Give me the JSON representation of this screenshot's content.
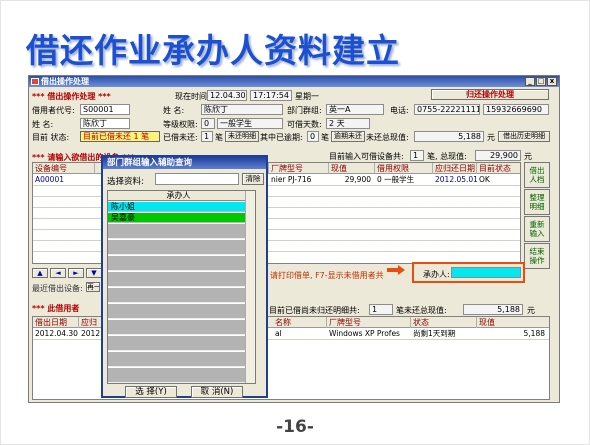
{
  "slide": {
    "title": "借还作业承办人资料建立",
    "page": "-16-"
  },
  "window": {
    "title": "借出操作处理",
    "ctrl_min": "_",
    "ctrl_max": "□",
    "ctrl_close": "x"
  },
  "form": {
    "section1": "***  借出操作处理  ***",
    "now_label": "现在时间:",
    "date": "12.04.30",
    "time": "17:17:54",
    "weekday": "星期一",
    "return_btn": "归还操作处理",
    "cert_label": "借用者代号:",
    "cert": "S00001",
    "name_label": "姓    名:",
    "name": "陈欣丁",
    "dept_label": "部门群组:",
    "dept": "英一A",
    "phone_label": "电话:",
    "phone": "0755-22221111",
    "mobile": "15932669690",
    "name2_label": "姓      名:",
    "name2": "陈欣丁",
    "perm_label": "等级权限:",
    "perm_code": "0",
    "perm_text": "一般学生",
    "days_label": "可借天数:",
    "days": "2 天",
    "status_label": "目前  状态:",
    "status": "目前已借未还 1 笔",
    "overdue_label": "已借未还:",
    "overdue": "1",
    "overdue_unit": "笔",
    "overdue_btn": "未还明细",
    "overdue_late": "其中已逾期:",
    "late_count": "0",
    "late_unit": "笔",
    "late_btn": "逾期未还",
    "total_label": "未还总现值:",
    "total": "5,188",
    "total_unit": "元",
    "history_btn": "借出历史明细",
    "section2": "*** 请输入欲借出的设备 ***",
    "input_total_label": "目前输入可借设备共:",
    "input_count": "1",
    "input_unit": "笔, 总现值:",
    "input_value": "29,900",
    "input_money": "元",
    "top_headers": [
      "设备编号",
      "",
      "",
      "厂牌型号",
      "现值",
      "借用权限",
      "应归还日期",
      "目前状态"
    ],
    "top_rows": [
      [
        "A00001",
        "",
        "",
        "nier PJ-716",
        "29,900",
        "0 一般学生",
        "2012.05.01",
        "OK"
      ]
    ],
    "side_buttons": [
      "借出\n人档",
      "整理\n明细",
      "重新\n输入",
      "结束\n操作"
    ],
    "nav_buttons": [
      "▲",
      "◄",
      "►",
      "▼"
    ],
    "warn": "请打印借单, F7-显示未借用者共",
    "handler_label": "承办人:",
    "handler_value": "",
    "last_label": "最近借出设备:",
    "last_btn": "再一",
    "section3": "*** 此借用者",
    "owe_label": "目前已借尚未归还明细共:",
    "owe_count": "1",
    "owe_unit": "笔未还总现值:",
    "owe_value": "5,188",
    "owe_money": "元",
    "bottom_headers": [
      "借出日期",
      "应归",
      "名称",
      "厂牌型号",
      "状态",
      "现值"
    ],
    "bottom_rows": [
      [
        "2012.04.30",
        "2012",
        "al",
        "Windows XP Profes",
        "尚剩1天到期",
        "5,188"
      ]
    ]
  },
  "dialog": {
    "title": "部门群组输入辅助查询",
    "query_label": "选择资料:",
    "query_value": "",
    "clear_btn": "清除",
    "list_header": "承办人",
    "list_items": [
      "陈小姐",
      "吴嘉豪"
    ],
    "ok_btn": "选 择(Y)",
    "cancel_btn": "取 消(N)"
  },
  "colors": {
    "title": "#1d4fd1",
    "cyan": "#00e8f0",
    "green": "#00c800",
    "highlight": "#e64f10",
    "deep_red": "#b00000"
  }
}
